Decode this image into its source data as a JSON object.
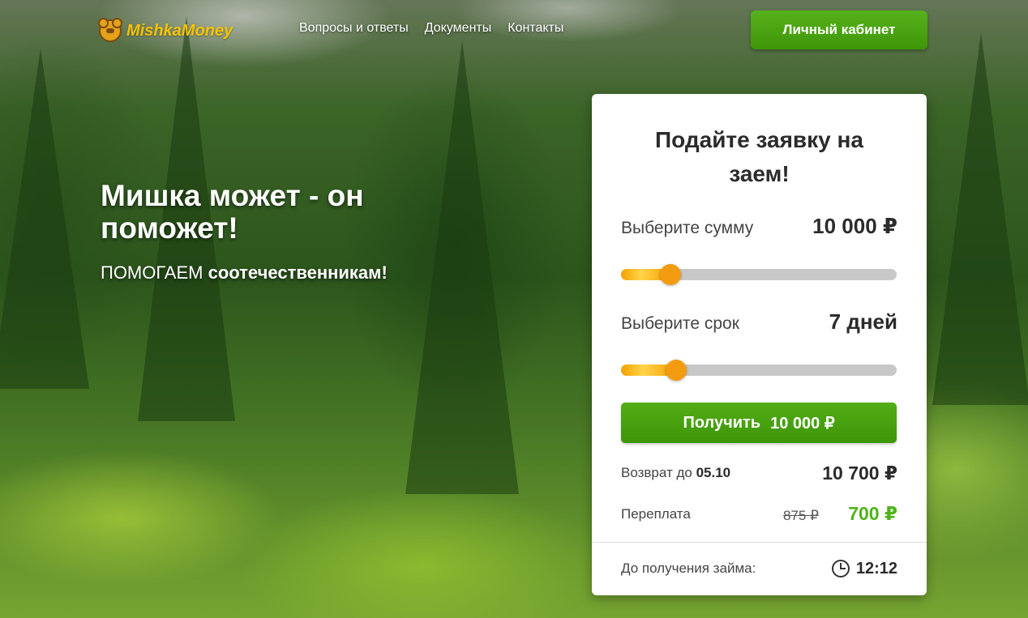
{
  "header": {
    "logo_text": "MishkaMoney",
    "nav": [
      "Вопросы и ответы",
      "Документы",
      "Контакты"
    ],
    "cabinet_label": "Личный кабинет"
  },
  "hero": {
    "title": "Мишка может - он поможет!",
    "subtitle_plain": "ПОМОГАЕМ ",
    "subtitle_bold": "соотечественникам!"
  },
  "form": {
    "title": "Подайте заявку на заем!",
    "amount_label": "Выберите сумму",
    "amount_value": "10 000 ₽",
    "amount_slider_fraction": 0.18,
    "term_label": "Выберите срок",
    "term_value": "7 дней",
    "term_slider_fraction": 0.2,
    "button_text": "Получить",
    "button_amount": "10 000 ₽",
    "return_label": "Возврат до ",
    "return_date": "05.10",
    "return_value": "10 700 ₽",
    "overpay_label": "Переплата",
    "overpay_old": "875 ₽",
    "overpay_new": "700 ₽",
    "until_label": "До получения займа:",
    "until_time": "12:12"
  },
  "colors": {
    "accent_green": "#4fb41b",
    "slider_orange": "#f39c12",
    "logo_yellow": "#f6c300"
  }
}
